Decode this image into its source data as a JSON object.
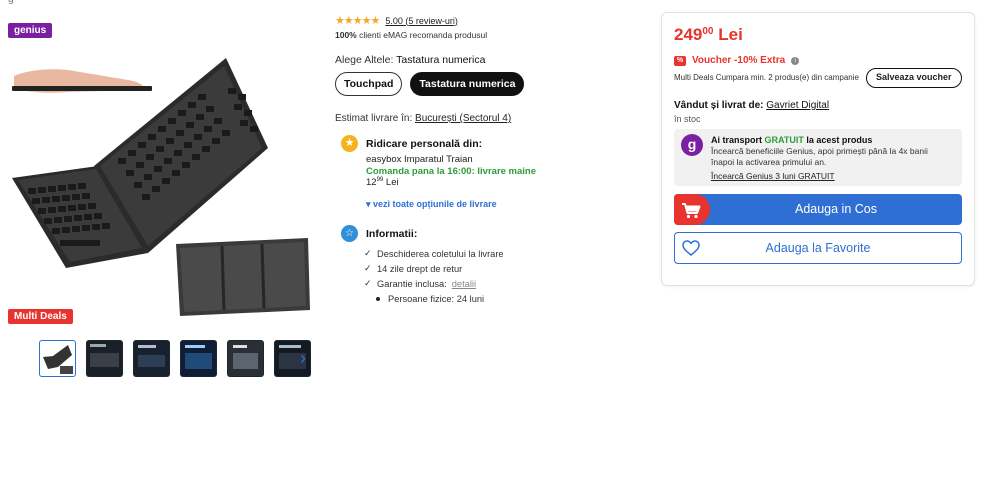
{
  "gallery": {
    "genius_badge": "genius",
    "multi_deals_badge": "Multi Deals",
    "thumbnails": [
      "keyboard-photo-1",
      "keyboard-photo-2",
      "keyboard-photo-3",
      "keyboard-photo-4",
      "keyboard-photo-5",
      "keyboard-photo-6"
    ],
    "next_icon": "chevron-right-icon"
  },
  "rating": {
    "stars": "★★★★★",
    "summary": "5.00 (5 review-uri)",
    "recommend_pct": "100%",
    "recommend_text": "clienti eMAG recomanda produsul"
  },
  "variant": {
    "label": "Alege Altele:",
    "selected": "Tastatura numerica",
    "options": [
      "Touchpad",
      "Tastatura numerica"
    ]
  },
  "delivery": {
    "estimate_label": "Estimat livrare în:",
    "estimate_location": "București (Sectorul 4)",
    "pickup_title": "Ridicare personală din:",
    "pickup_place": "easybox Imparatul Traian",
    "pickup_order": "Comanda pana la 16:00: livrare maine",
    "pickup_price_int": "12",
    "pickup_price_dec": "99",
    "pickup_currency": "Lei",
    "all_options": "vezi toate opțiunile de livrare"
  },
  "info": {
    "title": "Informatii:",
    "items": [
      "Deschiderea coletului la livrare",
      "14 zile drept de retur",
      "Garantie inclusa:"
    ],
    "details_link": "detalii",
    "warranty_sub": "Persoane fizice: 24 luni"
  },
  "buybox": {
    "price_int": "249",
    "price_dec": "00",
    "currency": "Lei",
    "voucher_tag": "%",
    "voucher_text": "Voucher -10% Extra",
    "multi_deals_text": "Multi Deals Cumpara min. 2 produs(e) din campanie",
    "save_voucher": "Salveaza voucher",
    "sold_by_label": "Vândut și livrat de:",
    "seller": "Gavriet Digital",
    "stock": "în stoc",
    "genius_letter": "g",
    "genius_title_prefix": "Ai transport",
    "genius_title_free": "GRATUIT",
    "genius_title_suffix": "la acest produs",
    "genius_desc": "Încearcă beneficiile Genius, apoi primești până la 4x banii înapoi la activarea primului an.",
    "genius_try": "Încearcă Genius 3 luni GRATUIT",
    "add_to_cart": "Adauga in Cos",
    "add_to_favorites": "Adauga la Favorite"
  },
  "colors": {
    "accent_blue": "#2f6fd3",
    "price_red": "#e8332e",
    "genius_purple": "#7a1fa2",
    "success_green": "#2e9c3a",
    "star_gold": "#f5a623"
  }
}
